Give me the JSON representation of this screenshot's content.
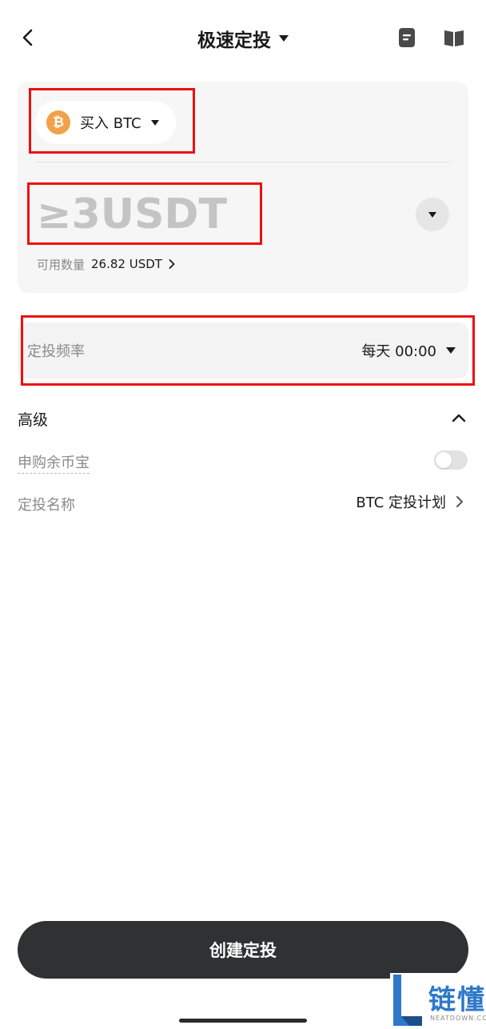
{
  "header": {
    "title": "极速定投"
  },
  "buy_card": {
    "coin_symbol": "₿",
    "buy_label": "买入 BTC",
    "amount_placeholder": "≥3USDT",
    "available_label": "可用数量",
    "available_value": "26.82 USDT"
  },
  "frequency": {
    "label": "定投频率",
    "value": "每天 00:00"
  },
  "advanced": {
    "title": "高级",
    "subscribe_label": "申购余币宝",
    "subscribe_enabled": false,
    "plan_name_label": "定投名称",
    "plan_name_value": "BTC 定投计划"
  },
  "footer": {
    "create_button": "创建定投"
  },
  "watermark": {
    "text": "链懂",
    "subtext": "NEATDOWN.COM"
  },
  "colors": {
    "accent_dark": "#2f3133",
    "btc_orange": "#f2a14a",
    "annotation_red": "#ee0f0f",
    "watermark_blue": "#2d78c9"
  },
  "icons": [
    "chevron-left-icon",
    "triangle-down-icon",
    "document-icon",
    "book-icon",
    "bitcoin-icon",
    "chevron-right-icon",
    "chevron-up-icon"
  ]
}
